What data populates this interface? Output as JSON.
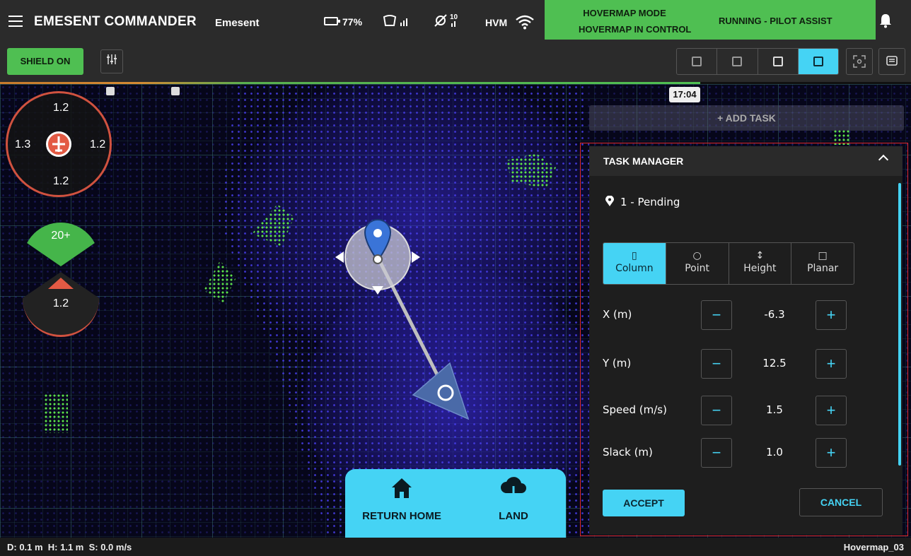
{
  "header": {
    "title": "EMESENT COMMANDER",
    "org": "Emesent",
    "battery": "77%",
    "satellites": "10",
    "link_label": "HVM",
    "mode_title": "HOVERMAP MODE",
    "mode_sub": "HOVERMAP IN CONTROL",
    "state": "RUNNING - PILOT ASSIST",
    "icons": [
      "menu-icon",
      "battery-icon",
      "remote-signal-icon",
      "satellite-icon",
      "wifi-icon",
      "bell-icon"
    ]
  },
  "toolbar": {
    "shield_label": "SHIELD ON",
    "view_modes": [
      "perspective",
      "front",
      "side",
      "top"
    ],
    "active_view": "top"
  },
  "map": {
    "time": "17:04",
    "add_task_label": "+ ADD TASK",
    "proximity": {
      "top": "1.2",
      "left": "1.3",
      "right": "1.2",
      "bottom": "1.2"
    },
    "vertical": {
      "up": "20+",
      "down": "1.2"
    },
    "actions": {
      "home_label": "RETURN HOME",
      "land_label": "LAND"
    }
  },
  "task_manager": {
    "title": "TASK MANAGER",
    "pending": "1 - Pending",
    "tabs": [
      {
        "label": "Column",
        "glyph": "▯"
      },
      {
        "label": "Point",
        "glyph": "○"
      },
      {
        "label": "Height",
        "glyph": "↕"
      },
      {
        "label": "Planar",
        "glyph": "□"
      }
    ],
    "active_tab": "Column",
    "fields": [
      {
        "label": "X (m)",
        "value": "-6.3"
      },
      {
        "label": "Y (m)",
        "value": "12.5"
      },
      {
        "label": "Speed (m/s)",
        "value": "1.5"
      },
      {
        "label": "Slack (m)",
        "value": "1.0"
      }
    ],
    "accept_label": "ACCEPT",
    "cancel_label": "CANCEL"
  },
  "status": {
    "readout": "D: 0.1 m  H: 1.1 m  S: 0.0 m/s",
    "device": "Hovermap_03"
  },
  "colors": {
    "accent": "#45d3f4",
    "mode_green": "#4fbf52",
    "warning_red": "#e35a44",
    "point_cloud": "#4a3cf0"
  }
}
